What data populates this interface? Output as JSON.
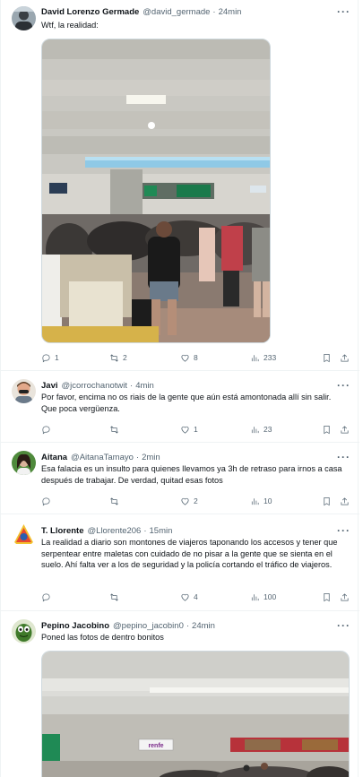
{
  "tweets": [
    {
      "name": "David Lorenzo Germade",
      "handle": "@david_germade",
      "separator": "·",
      "time": "24min",
      "text": "Wtf, la realidad:",
      "replies": "1",
      "retweets": "2",
      "likes": "8",
      "views": "233"
    },
    {
      "name": "Javi",
      "handle": "@jcorrochanotwit",
      "separator": "·",
      "time": "4min",
      "text": "Por favor, encima no os riais de la gente que aún está amontonada allí sin salir. Que poca vergüenza.",
      "replies": "",
      "retweets": "",
      "likes": "1",
      "views": "23"
    },
    {
      "name": "Aitana",
      "handle": "@AitanaTamayo",
      "separator": "·",
      "time": "2min",
      "text": "Esa falacia es un insulto para quienes llevamos ya 3h de retraso para irnos a casa después de trabajar. De verdad, quitad esas fotos",
      "replies": "",
      "retweets": "",
      "likes": "2",
      "views": "10"
    },
    {
      "name": "T. Llorente",
      "handle": "@Llorente206",
      "separator": "·",
      "time": "15min",
      "text": "La realidad a diario son montones de viajeros taponando los accesos y tener que serpentear entre maletas con cuidado de no pisar a la gente que se sienta en el suelo. Ahí falta ver a los de seguridad y la policía cortando el tráfico de viajeros.",
      "replies": "",
      "retweets": "",
      "likes": "4",
      "views": "100"
    },
    {
      "name": "Pepino Jacobino",
      "handle": "@pepino_jacobin0",
      "separator": "·",
      "time": "24min",
      "text": "Poned las fotos de dentro bonitos"
    }
  ],
  "more_label": "···",
  "photo2_sign": "renfe",
  "colors": {
    "text": "#0f1419",
    "secondary": "#536471",
    "border": "#eff3f4"
  },
  "icons": [
    "reply-icon",
    "retweet-icon",
    "like-icon",
    "views-icon",
    "bookmark-icon",
    "share-icon",
    "more-icon"
  ]
}
